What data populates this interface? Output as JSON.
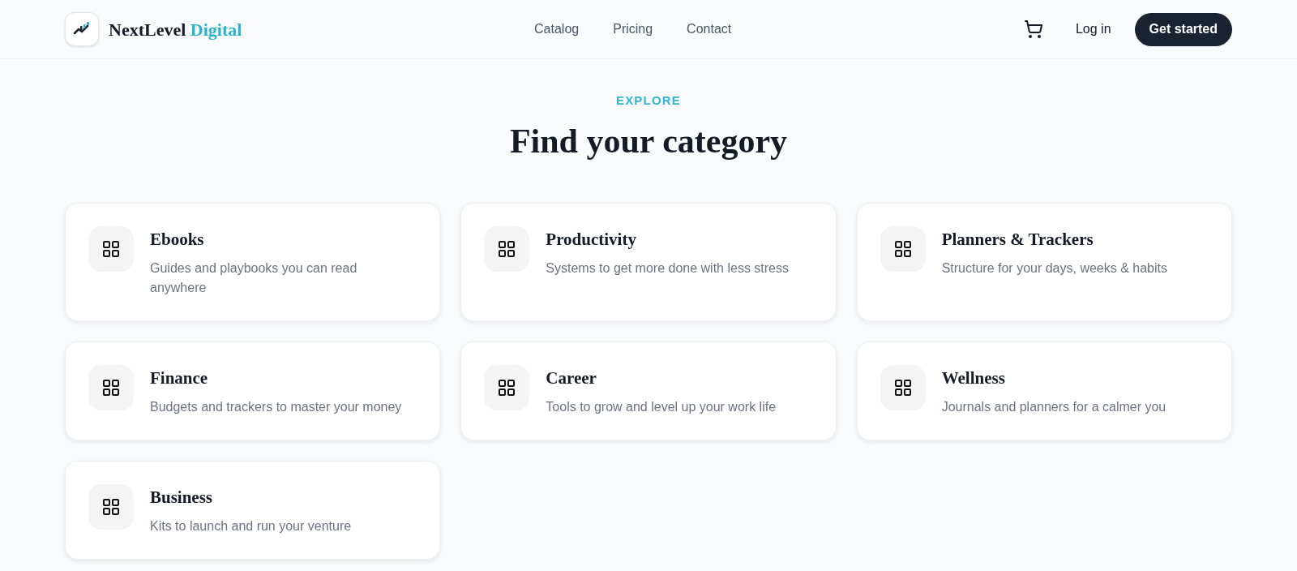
{
  "header": {
    "brand": "NextLevel",
    "brand_accent": "Digital",
    "nav": [
      "Catalog",
      "Pricing",
      "Contact"
    ],
    "login": "Log in",
    "cta": "Get started"
  },
  "hero": {
    "eyebrow": "EXPLORE",
    "title": "Find your category"
  },
  "categories": [
    {
      "title": "Ebooks",
      "description": "Guides and playbooks you can read anywhere"
    },
    {
      "title": "Productivity",
      "description": "Systems to get more done with less stress"
    },
    {
      "title": "Planners & Trackers",
      "description": "Structure for your days, weeks & habits"
    },
    {
      "title": "Finance",
      "description": "Budgets and trackers to master your money"
    },
    {
      "title": "Career",
      "description": "Tools to grow and level up your work life"
    },
    {
      "title": "Wellness",
      "description": "Journals and planners for a calmer you"
    },
    {
      "title": "Business",
      "description": "Kits to launch and run your venture"
    }
  ]
}
